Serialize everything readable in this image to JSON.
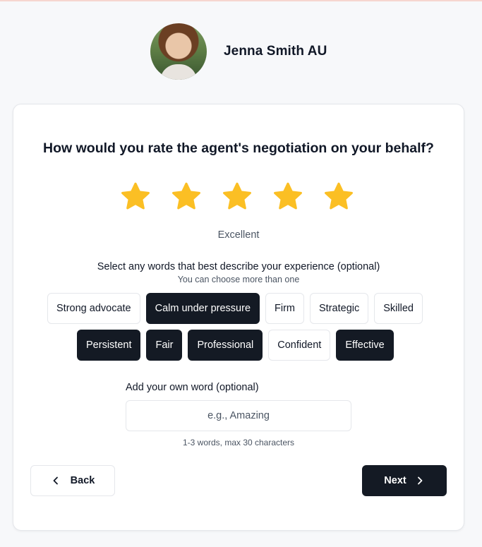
{
  "agent": {
    "name": "Jenna Smith AU"
  },
  "question": {
    "text": "How would you rate the agent's negotiation on your behalf?"
  },
  "rating": {
    "value": 5,
    "max": 5,
    "label": "Excellent",
    "color": "#fbbf24"
  },
  "words": {
    "prompt": "Select any words that best describe your experience (optional)",
    "hint": "You can choose more than one",
    "row1": [
      {
        "label": "Strong advocate",
        "selected": false
      },
      {
        "label": "Calm under pressure",
        "selected": true
      },
      {
        "label": "Firm",
        "selected": false
      },
      {
        "label": "Strategic",
        "selected": false
      },
      {
        "label": "Skilled",
        "selected": false
      }
    ],
    "row2": [
      {
        "label": "Persistent",
        "selected": true
      },
      {
        "label": "Fair",
        "selected": true
      },
      {
        "label": "Professional",
        "selected": true
      },
      {
        "label": "Confident",
        "selected": false
      },
      {
        "label": "Effective",
        "selected": true
      }
    ]
  },
  "own_word": {
    "label": "Add your own word (optional)",
    "placeholder": "e.g., Amazing",
    "value": "",
    "help": "1-3 words, max 30 characters"
  },
  "nav": {
    "back_label": "Back",
    "back_icon": "chevron-left-icon",
    "next_label": "Next",
    "next_icon": "chevron-right-icon"
  },
  "colors": {
    "selected_chip": "#141a24",
    "star": "#fbbf24"
  }
}
